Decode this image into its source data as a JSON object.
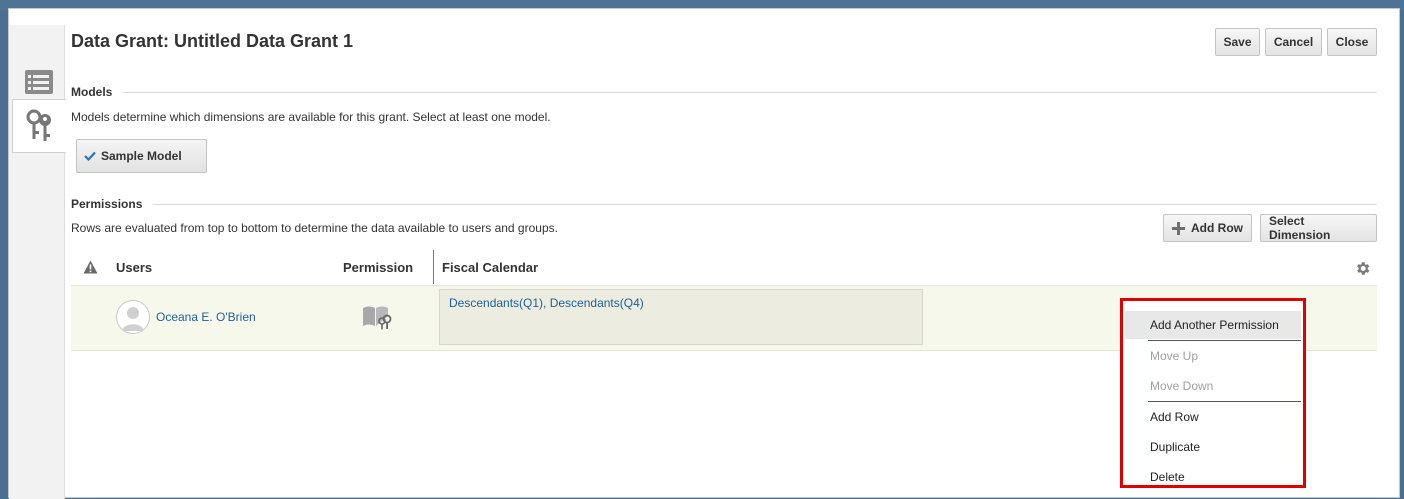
{
  "page": {
    "title": "Data Grant: Untitled Data Grant 1",
    "buttons": {
      "save": "Save",
      "cancel": "Cancel",
      "close": "Close"
    }
  },
  "siderail": {
    "tabs": [
      {
        "icon": "list-icon",
        "active": false
      },
      {
        "icon": "keys-icon",
        "active": true
      }
    ]
  },
  "models": {
    "title": "Models",
    "description": "Models determine which dimensions are available for this grant. Select at least one model.",
    "selected_model": "Sample Model",
    "check_icon": "checkmark-icon"
  },
  "permissions": {
    "title": "Permissions",
    "description": "Rows are evaluated from top to bottom to determine the data available to users and groups.",
    "add_row_label": "Add Row",
    "select_dimension_label": "Select Dimension",
    "columns": {
      "users": "Users",
      "permission": "Permission",
      "fiscal_calendar": "Fiscal Calendar"
    },
    "rows": [
      {
        "user": "Oceana E. O'Brien",
        "fiscal_calendar": "Descendants(Q1), Descendants(Q4)"
      }
    ]
  },
  "context_menu": {
    "items": [
      {
        "label": "Add Another Permission",
        "enabled": true
      },
      {
        "label": "Move Up",
        "enabled": false
      },
      {
        "label": "Move Down",
        "enabled": false
      },
      {
        "label": "Add Row",
        "enabled": true
      },
      {
        "label": "Duplicate",
        "enabled": true
      },
      {
        "label": "Delete",
        "enabled": true
      }
    ]
  },
  "colors": {
    "accent": "#3a87c8",
    "link": "#1d5f9a",
    "row_highlight": "#f7f8ec",
    "menu_outline": "#e00000",
    "check": "#2a73c2"
  }
}
